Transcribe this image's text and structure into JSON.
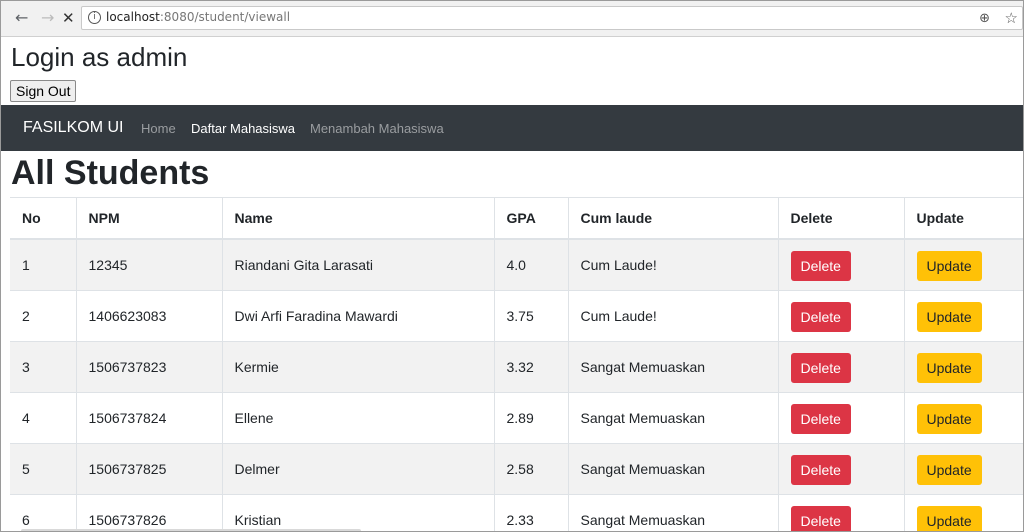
{
  "browser": {
    "url_host": "localhost",
    "url_path": ":8080/student/viewall"
  },
  "header": {
    "login_title": "Login as admin",
    "signout_label": "Sign Out"
  },
  "navbar": {
    "brand": "FASILKOM UI",
    "links": [
      {
        "label": "Home",
        "active": false
      },
      {
        "label": "Daftar Mahasiswa",
        "active": true
      },
      {
        "label": "Menambah Mahasiswa",
        "active": false
      }
    ]
  },
  "page_title": "All Students",
  "table": {
    "columns": [
      "No",
      "NPM",
      "Name",
      "GPA",
      "Cum laude",
      "Delete",
      "Update"
    ],
    "rows": [
      {
        "no": "1",
        "npm": "12345",
        "name": "Riandani Gita Larasati",
        "gpa": "4.0",
        "cum_laude": "Cum Laude!",
        "delete_label": "Delete",
        "update_label": "Update"
      },
      {
        "no": "2",
        "npm": "1406623083",
        "name": "Dwi Arfi Faradina Mawardi",
        "gpa": "3.75",
        "cum_laude": "Cum Laude!",
        "delete_label": "Delete",
        "update_label": "Update"
      },
      {
        "no": "3",
        "npm": "1506737823",
        "name": "Kermie",
        "gpa": "3.32",
        "cum_laude": "Sangat Memuaskan",
        "delete_label": "Delete",
        "update_label": "Update"
      },
      {
        "no": "4",
        "npm": "1506737824",
        "name": "Ellene",
        "gpa": "2.89",
        "cum_laude": "Sangat Memuaskan",
        "delete_label": "Delete",
        "update_label": "Update"
      },
      {
        "no": "5",
        "npm": "1506737825",
        "name": "Delmer",
        "gpa": "2.58",
        "cum_laude": "Sangat Memuaskan",
        "delete_label": "Delete",
        "update_label": "Update"
      },
      {
        "no": "6",
        "npm": "1506737826",
        "name": "Kristian",
        "gpa": "2.33",
        "cum_laude": "Sangat Memuaskan",
        "delete_label": "Delete",
        "update_label": "Update"
      }
    ]
  },
  "colors": {
    "navbar_bg": "#343a40",
    "delete_btn": "#dc3545",
    "update_btn": "#ffc107"
  }
}
